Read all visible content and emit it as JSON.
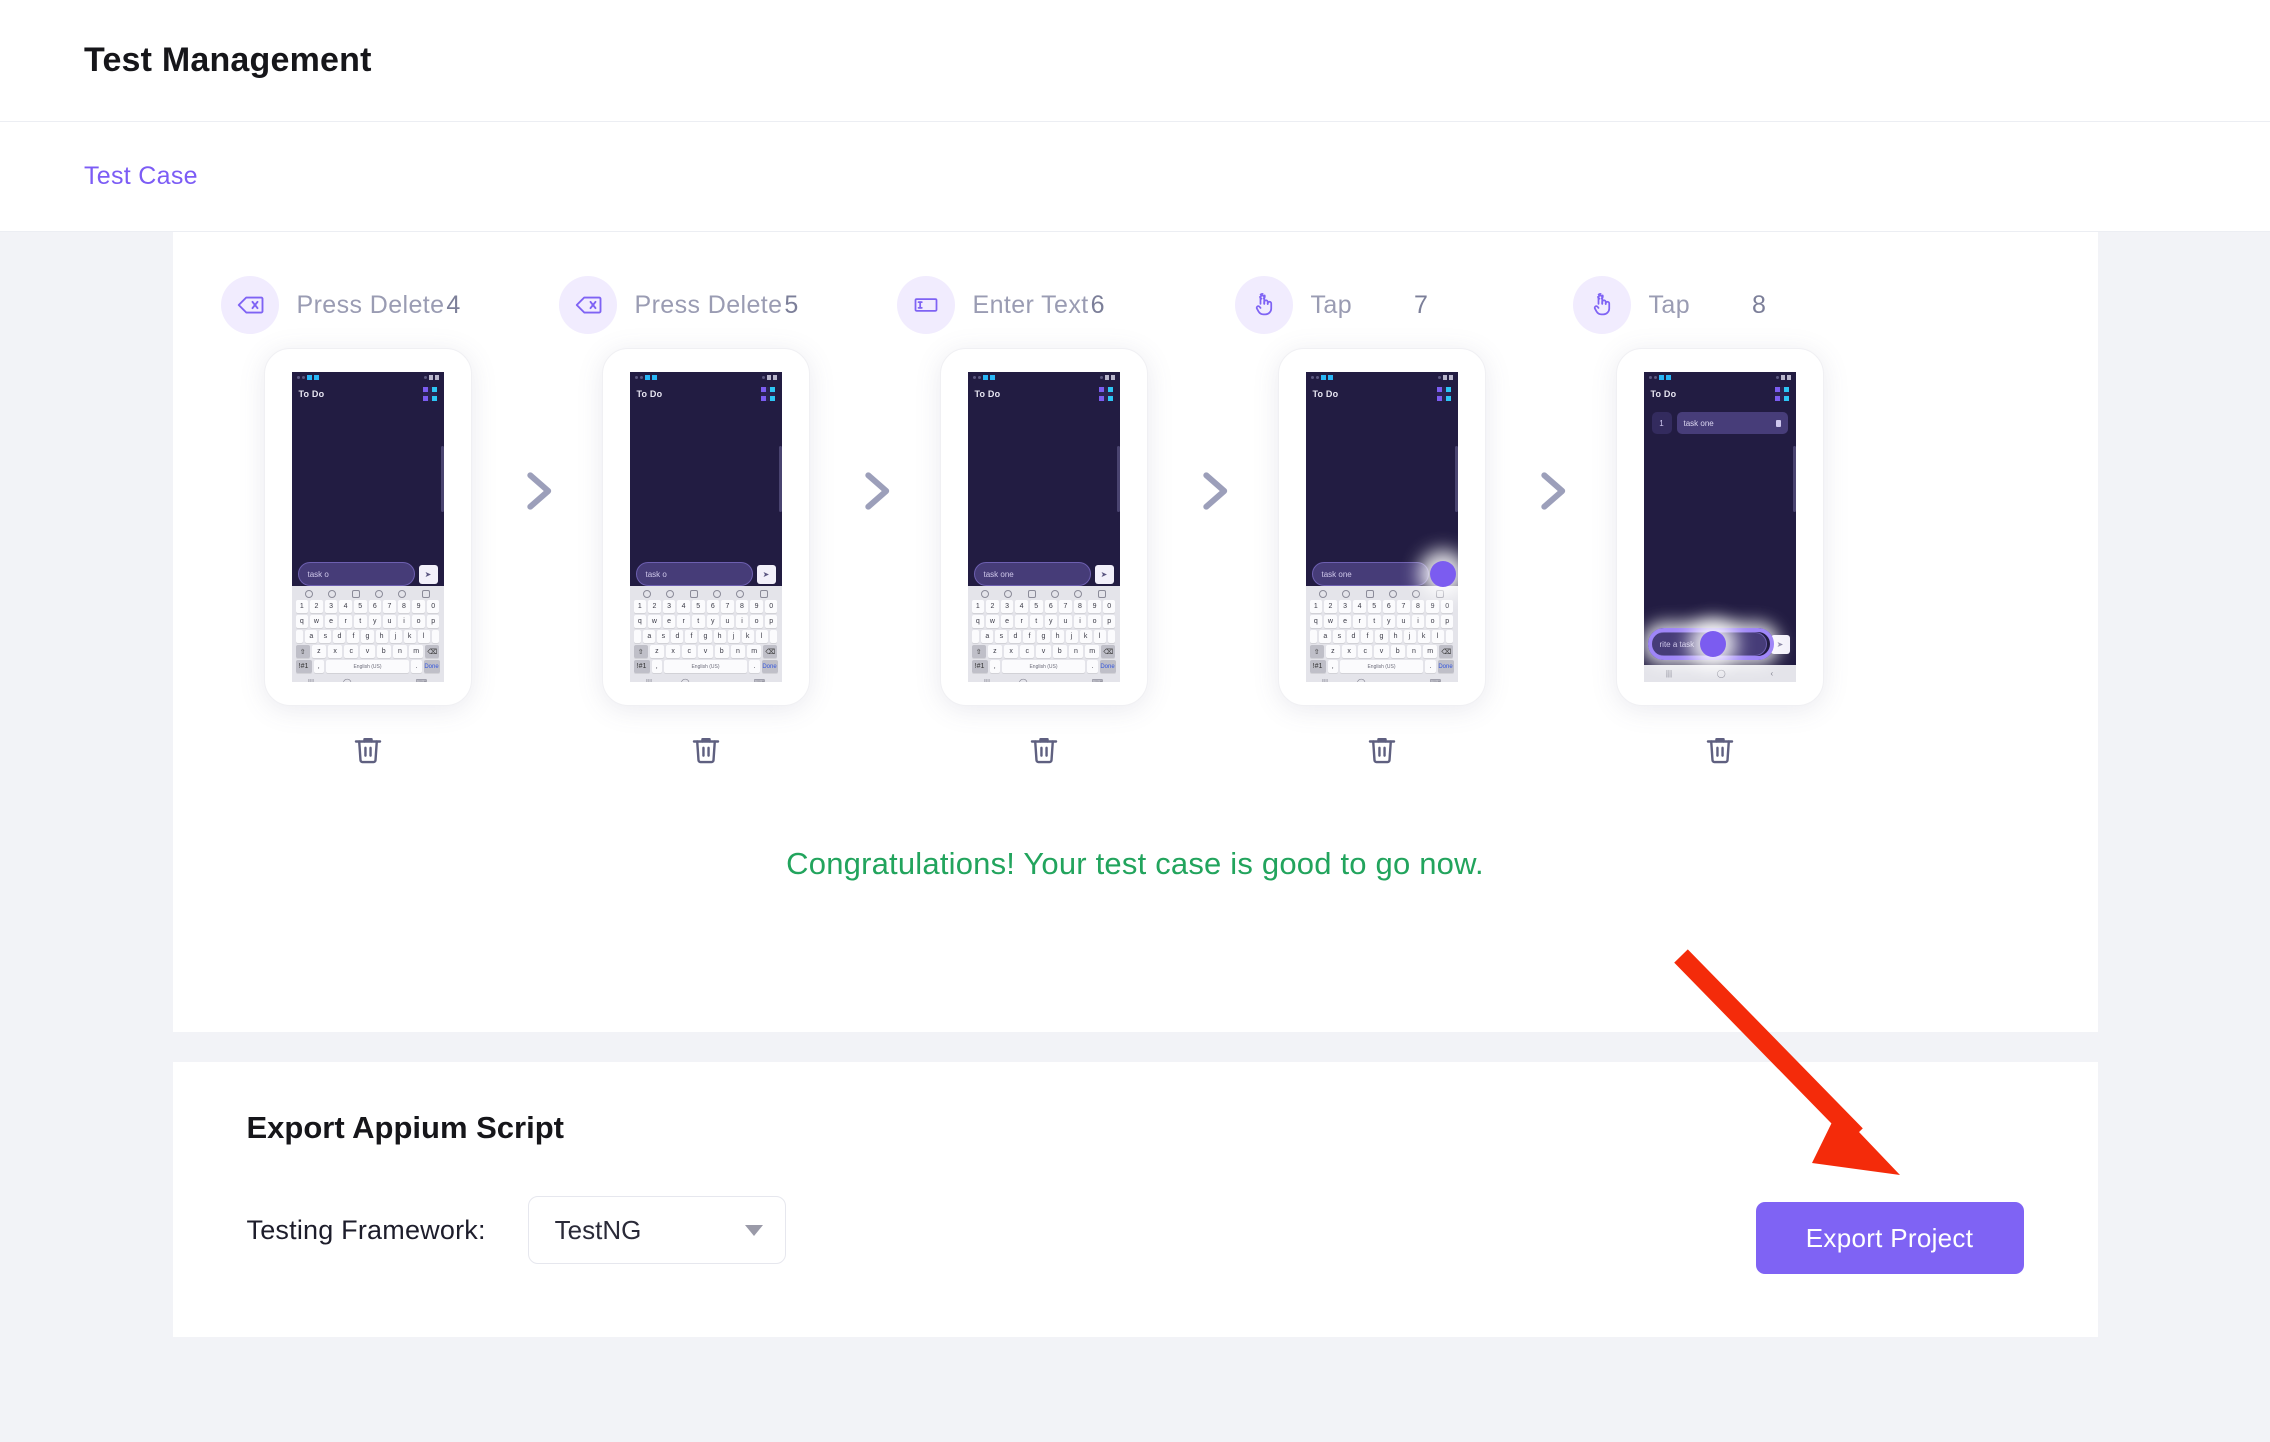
{
  "header": {
    "title": "Test Management"
  },
  "tabs": [
    {
      "label": "Test Case",
      "active": true
    }
  ],
  "steps": [
    {
      "action": "Press Delete",
      "number": "4",
      "icon": "backspace-delete-icon",
      "delete_label": "",
      "phone": {
        "app_title": "To Do",
        "input_text": "task o",
        "tasks": [],
        "keyboard": true,
        "tap_indicator": "none"
      }
    },
    {
      "action": "Press Delete",
      "number": "5",
      "icon": "backspace-delete-icon",
      "delete_label": "",
      "phone": {
        "app_title": "To Do",
        "input_text": "task o",
        "tasks": [],
        "keyboard": true,
        "tap_indicator": "none"
      }
    },
    {
      "action": "Enter Text",
      "number": "6",
      "icon": "text-input-icon",
      "delete_label": "",
      "phone": {
        "app_title": "To Do",
        "input_text": "task one",
        "tasks": [],
        "keyboard": true,
        "tap_indicator": "none"
      }
    },
    {
      "action": "Tap",
      "number": "7",
      "icon": "tap-finger-icon",
      "delete_label": "",
      "phone": {
        "app_title": "To Do",
        "input_text": "task one",
        "tasks": [],
        "keyboard": true,
        "tap_indicator": "send-button"
      }
    },
    {
      "action": "Tap",
      "number": "8",
      "icon": "tap-finger-icon",
      "delete_label": "",
      "phone": {
        "app_title": "To Do",
        "input_text": "rite a task",
        "tasks": [
          {
            "index": "1",
            "title": "task one"
          }
        ],
        "keyboard": false,
        "tap_indicator": "text-field"
      }
    }
  ],
  "keyboard": {
    "row_numbers": [
      "1",
      "2",
      "3",
      "4",
      "5",
      "6",
      "7",
      "8",
      "9",
      "0"
    ],
    "row_top": [
      "q",
      "w",
      "e",
      "r",
      "t",
      "y",
      "u",
      "i",
      "o",
      "p"
    ],
    "row_home": [
      "a",
      "s",
      "d",
      "f",
      "g",
      "h",
      "j",
      "k",
      "l"
    ],
    "row_bottom": [
      "z",
      "x",
      "c",
      "v",
      "b",
      "n",
      "m"
    ],
    "shift_key": "⇧",
    "backspace_key": "⌫",
    "symbols_key": "!#1",
    "comma_key": ",",
    "period_key": ".",
    "space_key": "English (US)",
    "done_key": "Done",
    "nav_recent": "|||",
    "nav_home": "◯",
    "nav_back": "⌄",
    "nav_keyboard": "⌨",
    "nav_back_alt": "‹"
  },
  "status": {
    "congratulations": "Congratulations! Your test case is good to go now."
  },
  "export": {
    "title": "Export Appium Script",
    "framework_label": "Testing Framework:",
    "framework_value": "TestNG",
    "framework_options": [
      "TestNG"
    ],
    "export_button": "Export Project"
  },
  "colors": {
    "accent_purple": "#7f63f4",
    "tab_purple": "#7c5cf5",
    "success_green": "#22a45d",
    "annotation_red": "#f42b0a",
    "page_bg": "#f2f3f7",
    "phone_screen": "#221c42"
  },
  "annotation": {
    "type": "arrow",
    "color": "#f42b0a",
    "points_to": "Export Project"
  }
}
